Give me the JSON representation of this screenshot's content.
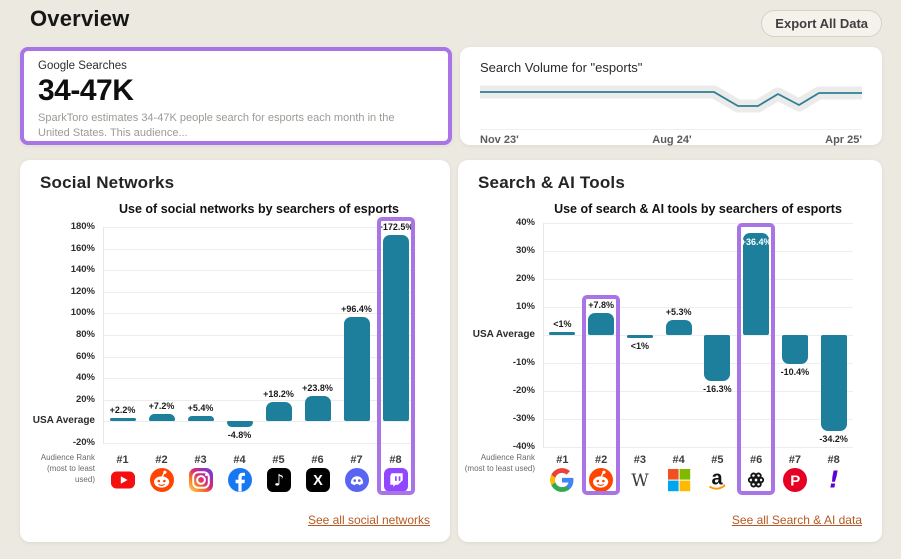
{
  "header": {
    "title": "Overview",
    "export_button": "Export All Data"
  },
  "google_searches": {
    "label": "Google Searches",
    "value": "34-47K",
    "description": "SparkToro estimates 34-47K people search for esports each month in the United States. This audience..."
  },
  "search_volume": {
    "title": "Search Volume for \"esports\"",
    "x_labels": [
      "Nov 23'",
      "Aug 24'",
      "Apr 25'"
    ],
    "line_color": "#2e7f96",
    "band_color": "#ebebe9",
    "points": [
      [
        0,
        11
      ],
      [
        234,
        11
      ],
      [
        258,
        25
      ],
      [
        278,
        25
      ],
      [
        298,
        13
      ],
      [
        319,
        24
      ],
      [
        339,
        12
      ],
      [
        382,
        12
      ]
    ]
  },
  "social_card": {
    "title": "Social Networks",
    "link": "See all social networks"
  },
  "search_card": {
    "title": "Search & AI Tools",
    "link": "See all Search & AI data"
  },
  "chart_data": [
    {
      "type": "bar",
      "title": "Use of social networks by searchers of esports",
      "categories": [
        "YouTube",
        "Reddit",
        "Instagram",
        "Facebook",
        "TikTok",
        "X",
        "Discord",
        "Twitch"
      ],
      "ranks": [
        "#1",
        "#2",
        "#3",
        "#4",
        "#5",
        "#6",
        "#7",
        "#8"
      ],
      "values": [
        2.2,
        7.2,
        5.4,
        -4.8,
        18.2,
        23.8,
        96.4,
        172.5
      ],
      "labels": [
        "+2.2%",
        "+7.2%",
        "+5.4%",
        "-4.8%",
        "+18.2%",
        "+23.8%",
        "+96.4%",
        "+172.5%"
      ],
      "ylim": [
        -20,
        180
      ],
      "ytick_step": 20,
      "zero_label": "USA Average",
      "xlabel": [
        "Audience Rank",
        "(most to least used)"
      ],
      "highlighted": [
        7
      ],
      "labels_inside": [],
      "bar_color": "#1d7f9c",
      "grid": true,
      "legend": false
    },
    {
      "type": "bar",
      "title": "Use of search & AI tools by searchers of esports",
      "categories": [
        "Google",
        "Reddit",
        "Wikipedia",
        "Microsoft",
        "Amazon",
        "ChatGPT",
        "Pinterest",
        "Yahoo"
      ],
      "ranks": [
        "#1",
        "#2",
        "#3",
        "#4",
        "#5",
        "#6",
        "#7",
        "#8"
      ],
      "values": [
        0.5,
        7.8,
        -0.5,
        5.3,
        -16.3,
        36.4,
        -10.4,
        -34.2
      ],
      "labels": [
        "<1%",
        "+7.8%",
        "<1%",
        "+5.3%",
        "-16.3%",
        "+36.4%",
        "-10.4%",
        "-34.2%"
      ],
      "ylim": [
        -40,
        40
      ],
      "ytick_step": 10,
      "zero_label": "USA Average",
      "xlabel": [
        "Audience Rank",
        "(most to least used)"
      ],
      "highlighted": [
        1,
        5
      ],
      "labels_inside": [
        5
      ],
      "bar_color": "#1d7f9c",
      "grid": true,
      "legend": false
    }
  ],
  "colors": {
    "accent_purple": "#a874e6",
    "bar_teal": "#1d7f9c",
    "link_orange": "#b55a22",
    "page_bg": "#ece9e1",
    "card_bg": "#ffffff"
  }
}
